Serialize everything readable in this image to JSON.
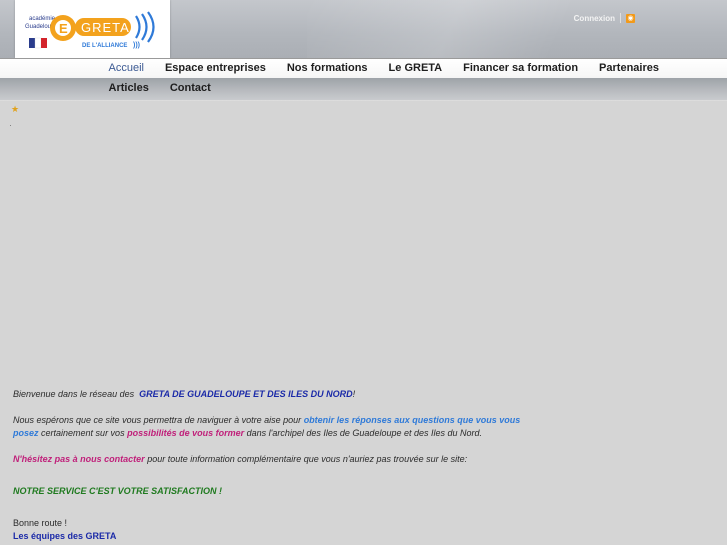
{
  "header": {
    "logo": {
      "academie_line1": "académie",
      "academie_line2": "Guadeloupe",
      "brand": "GRETA",
      "subtitle": "DE L'ALLIANCE"
    },
    "connexion_label": "Connexion",
    "rss_icon": "rss-icon"
  },
  "nav": {
    "items": [
      {
        "label": "Accueil"
      },
      {
        "label": "Espace entreprises"
      },
      {
        "label": "Nos formations"
      },
      {
        "label": "Le GRETA"
      },
      {
        "label": "Financer sa formation"
      },
      {
        "label": "Partenaires"
      },
      {
        "label": "Articles"
      },
      {
        "label": "Contact"
      }
    ]
  },
  "breadcrumb": {
    "icon": "home-star-icon",
    "marker": "·"
  },
  "content": {
    "welcome_prefix": "Bienvenue dans le réseau des",
    "welcome_title": "GRETA DE GUADELOUPE ET DES ILES DU NORD",
    "welcome_suffix": "!",
    "p2_a": "Nous espérons que ce site vous permettra de naviguer à votre aise pour",
    "p2_link": "obtenir les réponses aux questions que vous vous posez",
    "p2_b": "certainement sur vos",
    "p2_link2": "possibilités de vous former",
    "p2_c": "dans l'archipel des Iles de Guadeloupe et des Iles du Nord.",
    "p3_link": "N'hésitez pas à nous contacter",
    "p3_text": "pour toute  information complémentaire que vous n'auriez pas trouvée sur le site:",
    "p4": "NOTRE SERVICE C'EST VOTRE SATISFACTION !",
    "p5_line1": "Bonne route !",
    "p5_line2": "Les équipes des GRETA"
  },
  "colors": {
    "accent_blue": "#1b2aa8",
    "link_blue": "#2f7ad8",
    "magenta": "#c0207a",
    "green": "#1f7a1f",
    "orange": "#f29a1a"
  }
}
